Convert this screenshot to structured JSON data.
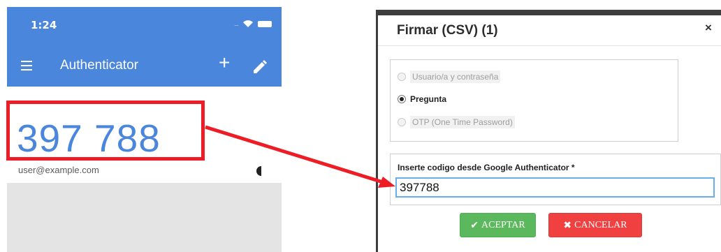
{
  "phone": {
    "status_time": "1:24",
    "app_title": "Authenticator",
    "otp_code": "397 788",
    "account_email": "user@example.com",
    "icons": [
      "menu-icon",
      "add-icon",
      "edit-icon",
      "wifi-icon",
      "battery-icon",
      "timer-icon"
    ]
  },
  "modal": {
    "title": "Firmar (CSV) (1)",
    "close_label": "×",
    "options": [
      {
        "label": "Usuario/a y contraseña",
        "state": "disabled"
      },
      {
        "label": "Pregunta",
        "state": "selected"
      },
      {
        "label": "OTP (One Time Password)",
        "state": "disabled"
      }
    ],
    "code_label": "Inserte codigo desde Google Authenticator *",
    "code_value": "397788",
    "accept_label": "ACEPTAR",
    "cancel_label": "CANCELAR"
  },
  "colors": {
    "app_blue": "#4a86dc",
    "highlight_red": "#ee1c24",
    "accept_green": "#5cb85c",
    "cancel_red": "#f04040"
  }
}
